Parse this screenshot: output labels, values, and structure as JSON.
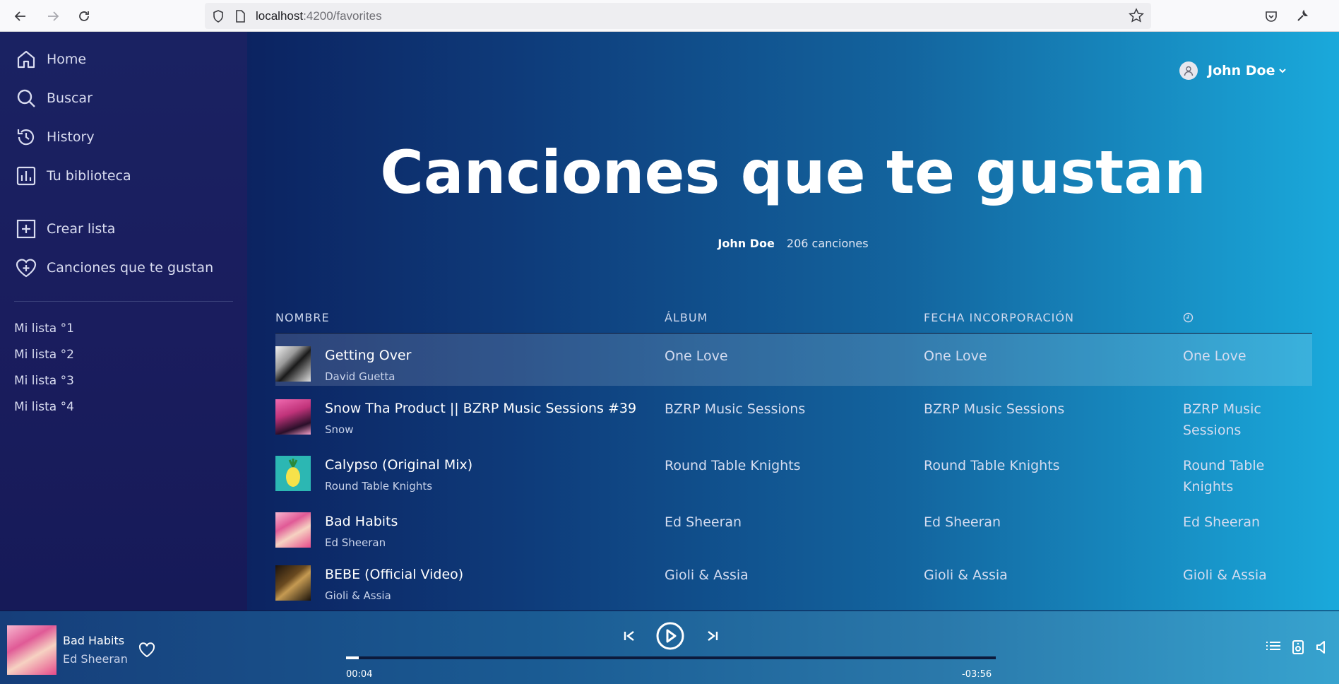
{
  "browser": {
    "url_host": "localhost",
    "url_rest": ":4200/favorites"
  },
  "sidebar": {
    "nav": [
      {
        "label": "Home",
        "icon": "home-icon"
      },
      {
        "label": "Buscar",
        "icon": "search-icon"
      },
      {
        "label": "History",
        "icon": "history-icon"
      },
      {
        "label": "Tu biblioteca",
        "icon": "library-icon"
      }
    ],
    "actions": [
      {
        "label": "Crear lista",
        "icon": "add-box-icon"
      },
      {
        "label": "Canciones que te gustan",
        "icon": "heart-plus-icon"
      }
    ],
    "playlists": [
      "Mi lista °1",
      "Mi lista °2",
      "Mi lista °3",
      "Mi lista °4"
    ]
  },
  "header": {
    "user_name": "John Doe",
    "user_chevron": "chevron-down-icon"
  },
  "page": {
    "title": "Canciones que te gustan",
    "owner": "John Doe",
    "count": "206 canciones"
  },
  "table": {
    "columns": [
      "NOMBRE",
      "ÁLBUM",
      "FECHA INCORPORACIÓN",
      "clock-icon"
    ],
    "rows": [
      {
        "title": "Getting Over",
        "artist": "David Guetta",
        "album": "One Love",
        "date": "One Love",
        "duration": "One Love"
      },
      {
        "title": "Snow Tha Product || BZRP Music Sessions #39",
        "artist": "Snow",
        "album": "BZRP Music Sessions",
        "date": "BZRP Music Sessions",
        "duration": "BZRP Music Sessions"
      },
      {
        "title": "Calypso (Original Mix)",
        "artist": "Round Table Knights",
        "album": "Round Table Knights",
        "date": "Round Table Knights",
        "duration": "Round Table Knights"
      },
      {
        "title": "Bad Habits",
        "artist": "Ed Sheeran",
        "album": "Ed Sheeran",
        "date": "Ed Sheeran",
        "duration": "Ed Sheeran"
      },
      {
        "title": "BEBE (Official Video)",
        "artist": "Gioli & Assia",
        "album": "Gioli & Assia",
        "date": "Gioli & Assia",
        "duration": "Gioli & Assia"
      }
    ]
  },
  "player": {
    "title": "Bad Habits",
    "artist": "Ed Sheeran",
    "elapsed": "00:04",
    "remaining": "-03:56",
    "progress_fraction": 0.02
  },
  "colors": {
    "sidebar_bg": "#1a2262",
    "main_gradient_start": "#0c2361",
    "main_gradient_end": "#1aa9db",
    "active_row": "rgba(255,255,255,0.14)"
  }
}
